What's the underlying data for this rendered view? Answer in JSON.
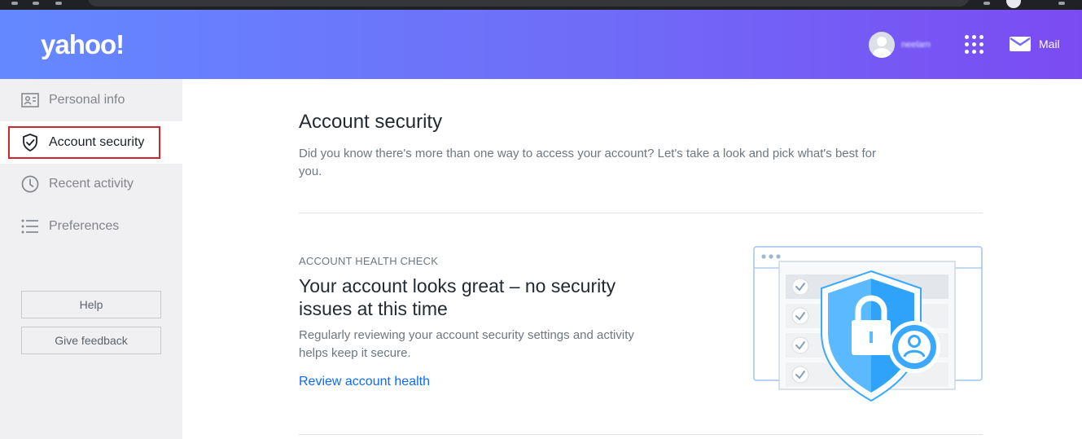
{
  "header": {
    "logo": "yahoo!",
    "user_name": "neelam",
    "mail_label": "Mail"
  },
  "sidebar": {
    "items": [
      {
        "label": "Personal info",
        "icon": "id-card-icon"
      },
      {
        "label": "Account security",
        "icon": "shield-check-icon",
        "active": true
      },
      {
        "label": "Recent activity",
        "icon": "clock-icon"
      },
      {
        "label": "Preferences",
        "icon": "list-icon"
      }
    ],
    "help_label": "Help",
    "feedback_label": "Give feedback"
  },
  "main": {
    "title": "Account security",
    "intro": "Did you know there's more than one way to access your account? Let's take a look and pick what's best for you.",
    "health": {
      "eyebrow": "ACCOUNT HEALTH CHECK",
      "headline": "Your account looks great – no security issues at this time",
      "description": "Regularly reviewing your account security settings and activity helps keep it secure.",
      "link": "Review account health"
    }
  },
  "colors": {
    "header_gradient_start": "#6489ff",
    "header_gradient_end": "#7b4bf2",
    "link": "#0f69ff",
    "active_outline": "#d0252a",
    "shield": "#3aa8ff"
  }
}
